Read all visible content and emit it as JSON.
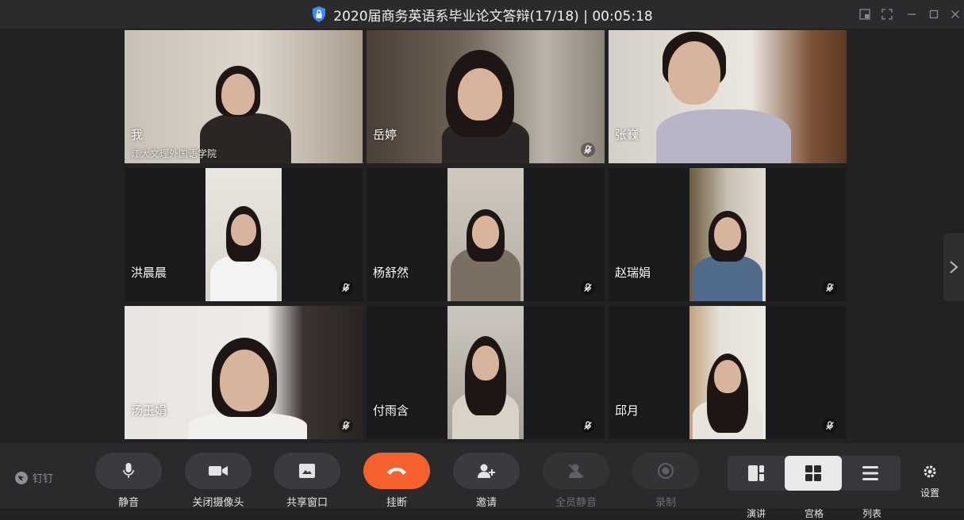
{
  "window": {
    "title": "2020届商务英语系毕业论文答辩(17/18) | 00:05:18",
    "controls": [
      "pip-icon",
      "fullscreen-icon",
      "minimize-icon",
      "maximize-icon",
      "close-icon"
    ]
  },
  "participants": [
    {
      "name": "我",
      "org": "江大文理外国语学院",
      "muted": false
    },
    {
      "name": "岳婷",
      "muted": true
    },
    {
      "name": "张巍",
      "muted": false
    },
    {
      "name": "洪晨晨",
      "muted": true
    },
    {
      "name": "杨舒然",
      "muted": true
    },
    {
      "name": "赵瑞娟",
      "muted": true
    },
    {
      "name": "汤玉娟",
      "muted": true
    },
    {
      "name": "付雨含",
      "muted": true
    },
    {
      "name": "邱月",
      "muted": true
    }
  ],
  "toolbar": {
    "brand": "钉钉",
    "mute_label": "静音",
    "camera_label": "关闭摄像头",
    "share_label": "共享窗口",
    "hangup_label": "挂断",
    "invite_label": "邀请",
    "muteall_label": "全员静音",
    "record_label": "录制",
    "view_speaker_label": "演讲",
    "view_grid_label": "宫格",
    "view_list_label": "列表",
    "settings_label": "设置"
  },
  "colors": {
    "hangup": "#f5612d",
    "shield": "#3d8bff",
    "background": "#232325"
  }
}
